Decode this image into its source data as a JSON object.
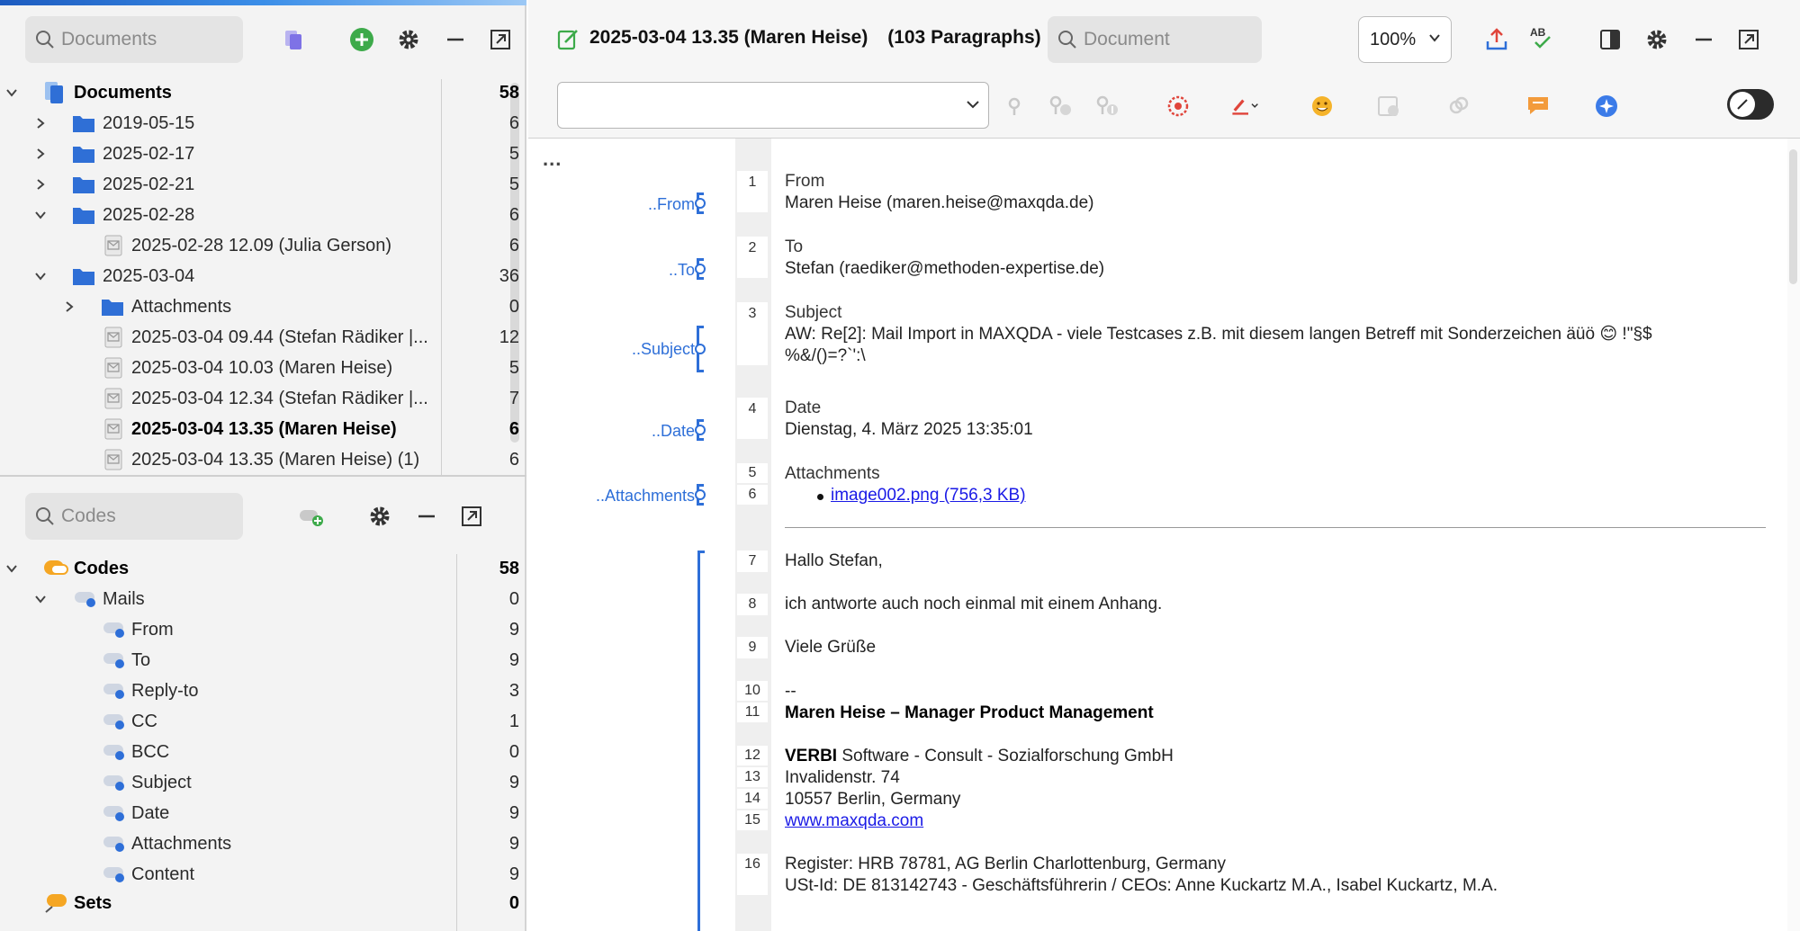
{
  "documents": {
    "search_placeholder": "Documents",
    "root": {
      "label": "Documents",
      "count": "58"
    },
    "items": [
      {
        "label": "2019-05-15",
        "count": "6"
      },
      {
        "label": "2025-02-17",
        "count": "5"
      },
      {
        "label": "2025-02-21",
        "count": "5"
      },
      {
        "label": "2025-02-28",
        "count": "6"
      },
      {
        "label": "2025-02-28 12.09 (Julia Gerson)",
        "count": "6"
      },
      {
        "label": "2025-03-04",
        "count": "36"
      },
      {
        "label": "Attachments",
        "count": "0"
      },
      {
        "label": "2025-03-04 09.44 (Stefan Rädiker |...",
        "count": "12"
      },
      {
        "label": "2025-03-04 10.03 (Maren Heise)",
        "count": "5"
      },
      {
        "label": "2025-03-04 12.34 (Stefan Rädiker |...",
        "count": "7"
      },
      {
        "label": "2025-03-04 13.35 (Maren Heise)",
        "count": "6"
      },
      {
        "label": "2025-03-04 13.35 (Maren Heise) (1)",
        "count": "6"
      }
    ]
  },
  "codes": {
    "search_placeholder": "Codes",
    "root": {
      "label": "Codes",
      "count": "58"
    },
    "items": [
      {
        "label": "Mails",
        "count": "0"
      },
      {
        "label": "From",
        "count": "9"
      },
      {
        "label": "To",
        "count": "9"
      },
      {
        "label": "Reply-to",
        "count": "3"
      },
      {
        "label": "CC",
        "count": "1"
      },
      {
        "label": "BCC",
        "count": "0"
      },
      {
        "label": "Subject",
        "count": "9"
      },
      {
        "label": "Date",
        "count": "9"
      },
      {
        "label": "Attachments",
        "count": "9"
      },
      {
        "label": "Content",
        "count": "9"
      }
    ],
    "sets": {
      "label": "Sets",
      "count": "0"
    }
  },
  "browser": {
    "title": "2025-03-04 13.35 (Maren Heise)",
    "paragraphs": "(103 Paragraphs)",
    "search_placeholder": "Document",
    "zoom": "100%",
    "more": "..."
  },
  "margin_codes": {
    "from": "..From",
    "to": "..To",
    "subject": "..Subject",
    "date": "..Date",
    "attachments": "..Attachments"
  },
  "line_numbers": [
    "1",
    "2",
    "3",
    "4",
    "5",
    "6",
    "7",
    "8",
    "9",
    "10",
    "11",
    "12",
    "13",
    "14",
    "15",
    "16"
  ],
  "document": {
    "p1_label": "From",
    "p1_value": "Maren Heise (maren.heise@maxqda.de)",
    "p2_label": "To",
    "p2_value": "Stefan (raediker@methoden-expertise.de)",
    "p3_label": "Subject",
    "p3_value_a": "AW: Re[2]: Mail Import in MAXQDA - viele Testcases z.B. mit diesem langen Betreff mit Sonderzeichen äüö 😊 !\"§$",
    "p3_value_b": "%&/()=?`':\\",
    "p4_label": "Date",
    "p4_value": "Dienstag, 4. März 2025 13:35:01",
    "p5_label": "Attachments",
    "p6_value": "image002.png (756,3 KB)",
    "p7": "Hallo Stefan,",
    "p8": "ich antworte auch noch einmal mit einem Anhang.",
    "p9": "Viele Grüße",
    "p10": "--",
    "p11": "Maren Heise – Manager Product Management",
    "p12_bold": "VERBI",
    "p12_rest": " Software - Consult - Sozialforschung GmbH",
    "p13": "Invalidenstr. 74",
    "p14": "10557 Berlin, Germany",
    "p15": "www.maxqda.com",
    "p16a": "Register: HRB 78781, AG Berlin Charlottenburg, Germany",
    "p16b": "USt-Id: DE 813142743 - Geschäftsführerin / CEOs: Anne Kuckartz M.A., Isabel Kuckartz, M.A."
  }
}
